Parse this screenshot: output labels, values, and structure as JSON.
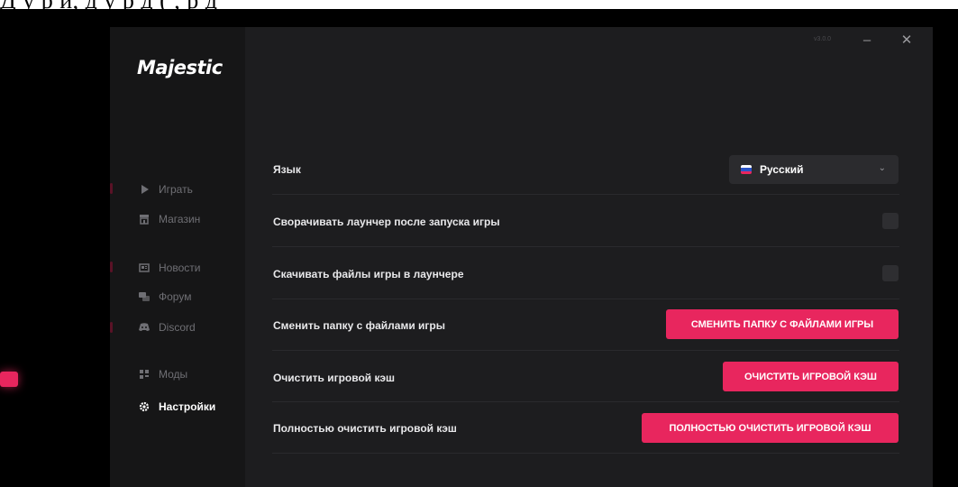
{
  "top_strip": {
    "text": "Д          у           р   и,             д    у   р    д     (           ,    р     д"
  },
  "app": {
    "logo": "Majestic",
    "version": "v3.0.0",
    "minimize_label": "–",
    "close_label": "✕"
  },
  "sidebar": {
    "items": [
      {
        "label": "Играть",
        "icon": "play-icon"
      },
      {
        "label": "Магазин",
        "icon": "shop-icon"
      },
      {
        "label": "Новости",
        "icon": "news-icon"
      },
      {
        "label": "Форум",
        "icon": "forum-icon"
      },
      {
        "label": "Discord",
        "icon": "discord-icon"
      },
      {
        "label": "Моды",
        "icon": "mods-icon"
      },
      {
        "label": "Настройки",
        "icon": "gear-icon",
        "active": true
      }
    ]
  },
  "settings": {
    "language": {
      "label": "Язык",
      "selected": "Русский"
    },
    "minimize_after_launch": {
      "label": "Сворачивать лаунчер после запуска игры",
      "checked": false
    },
    "download_in_launcher": {
      "label": "Скачивать файлы игры в лаунчере",
      "checked": false
    },
    "change_folder": {
      "label": "Сменить папку с файлами игры",
      "button": "СМЕНИТЬ ПАПКУ С ФАЙЛАМИ ИГРЫ"
    },
    "clear_cache": {
      "label": "Очистить игровой кэш",
      "button": "ОЧИСТИТЬ ИГРОВОЙ КЭШ"
    },
    "full_clear_cache": {
      "label": "Полностью очистить игровой кэш",
      "button": "ПОЛНОСТЬЮ ОЧИСТИТЬ ИГРОВОЙ КЭШ"
    }
  },
  "colors": {
    "accent": "#e8265e",
    "background": "#1d1d1f",
    "sidebar": "#161617"
  }
}
